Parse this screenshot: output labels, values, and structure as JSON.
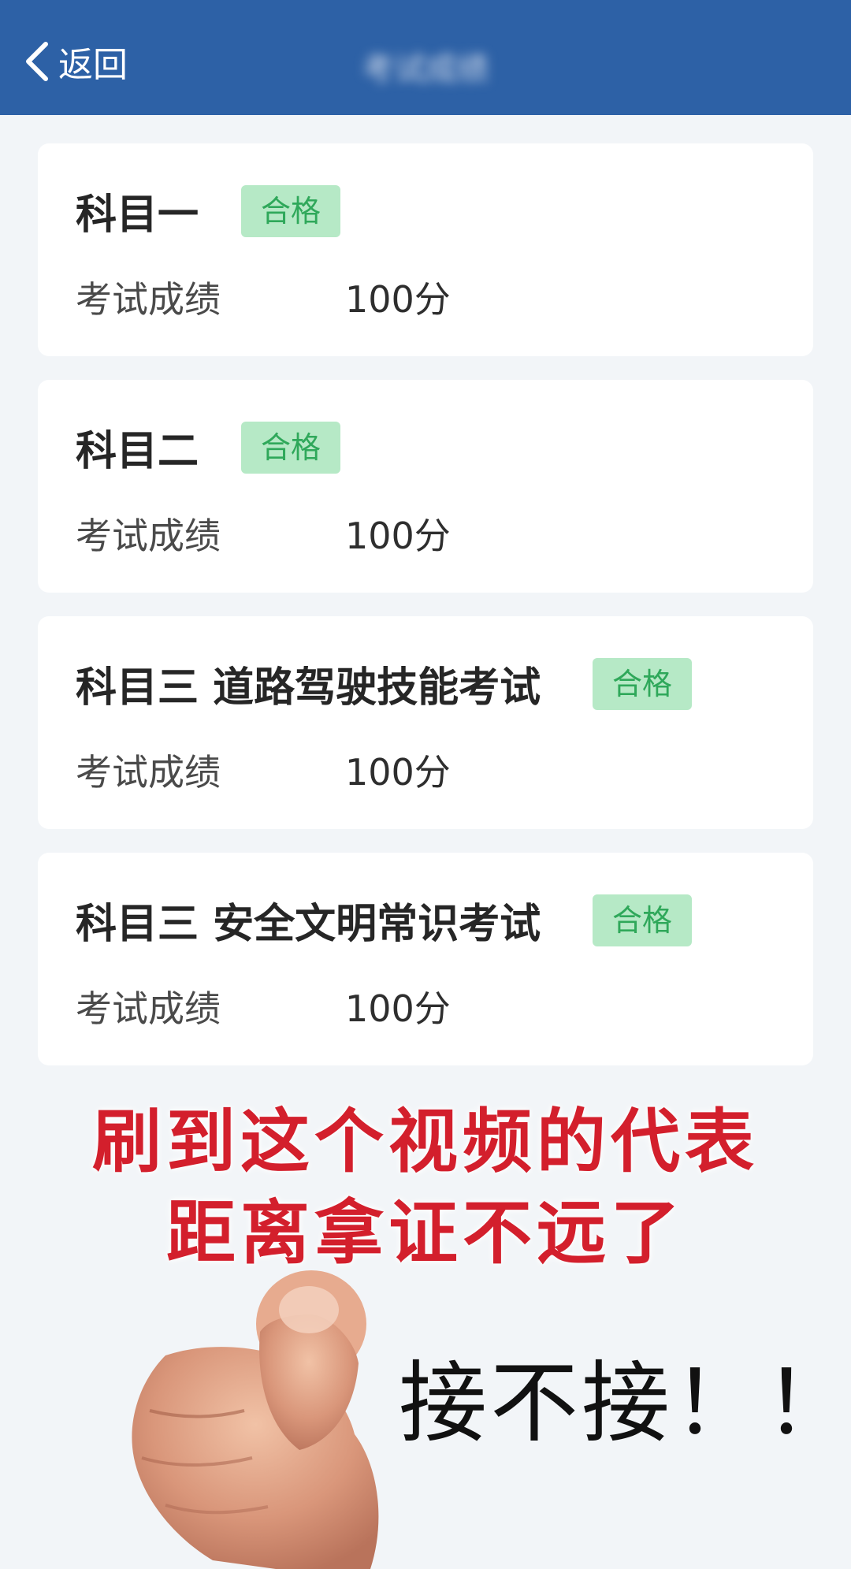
{
  "header": {
    "back_label": "返回",
    "title": "考试成绩"
  },
  "cards": [
    {
      "subject": "科目一",
      "status": "合格",
      "score_label": "考试成绩",
      "score": "100分"
    },
    {
      "subject": "科目二",
      "status": "合格",
      "score_label": "考试成绩",
      "score": "100分"
    },
    {
      "subject": "科目三 道路驾驶技能考试",
      "status": "合格",
      "score_label": "考试成绩",
      "score": "100分"
    },
    {
      "subject": "科目三 安全文明常识考试",
      "status": "合格",
      "score_label": "考试成绩",
      "score": "100分"
    }
  ],
  "overlay": {
    "line1": "刷到这个视频的代表",
    "line2": "距离拿证不远了",
    "caption": "接不接！！"
  },
  "colors": {
    "header_bg": "#2d61a6",
    "badge_bg": "#b6e9c6",
    "badge_text": "#2fa85a",
    "overlay_red": "#d31f2c"
  },
  "icons": [
    "chevron-left-icon",
    "pointing-hand-icon"
  ]
}
